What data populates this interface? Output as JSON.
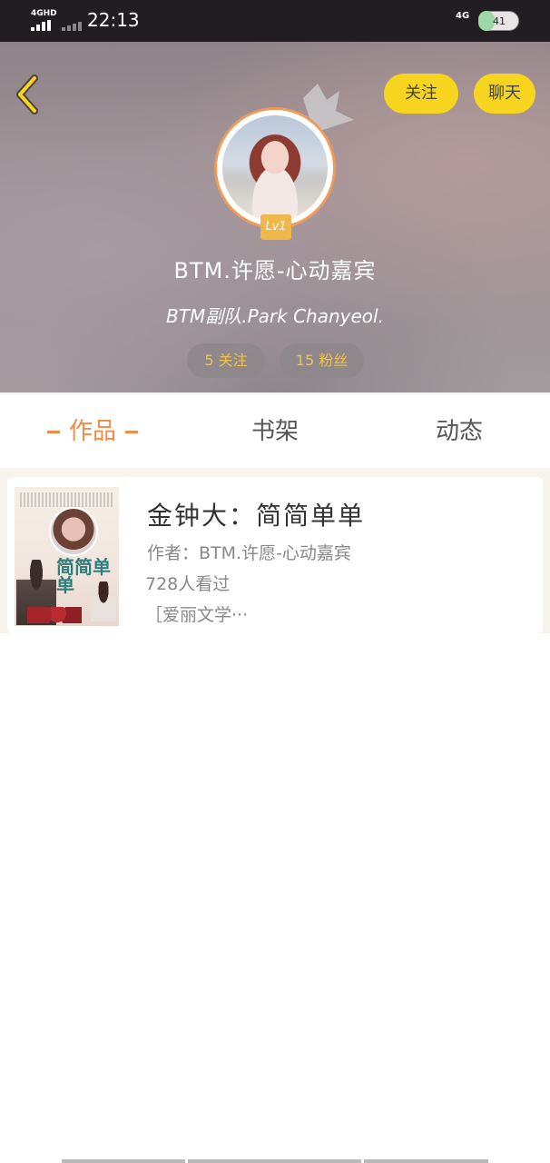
{
  "status_bar": {
    "network_left": "4GHD",
    "time": "22:13",
    "network_right": "4G",
    "battery": "41"
  },
  "header": {
    "follow_label": "关注",
    "chat_label": "聊天",
    "level": "Lv1",
    "username": "BTM.许愿-心动嘉宾",
    "bio": "BTM副队.Park Chanyeol.",
    "following": "5 关注",
    "followers": "15 粉丝"
  },
  "tabs": [
    {
      "label": "作品",
      "active": true
    },
    {
      "label": "书架",
      "active": false
    },
    {
      "label": "动态",
      "active": false
    }
  ],
  "works": [
    {
      "title": "金钟大：简简单单",
      "author": "作者：BTM.许愿-心动嘉宾",
      "views": "728人看过",
      "tag": "［爱丽文学···",
      "cover_title": "简简单单"
    }
  ],
  "colors": {
    "accent": "#f08a45",
    "button_yellow": "#f7d51f",
    "stat_text": "#f2c24a"
  }
}
